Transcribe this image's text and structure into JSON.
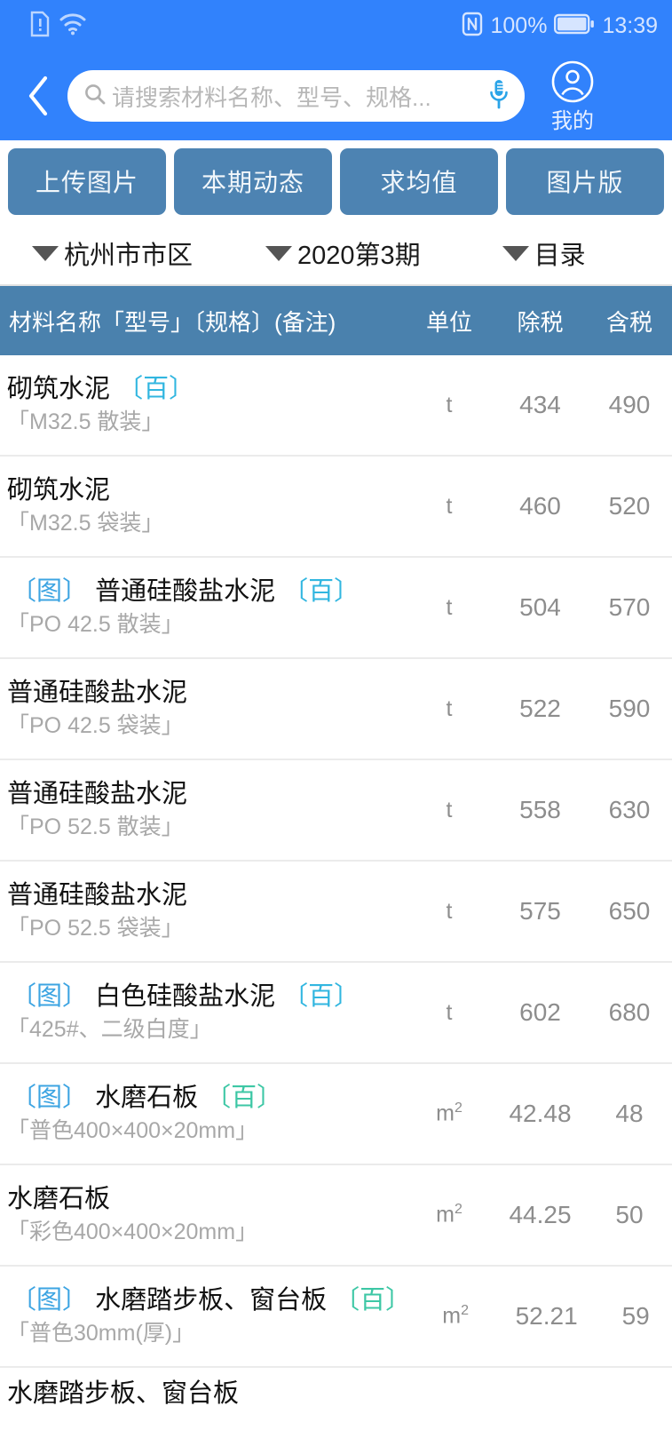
{
  "status_bar": {
    "icons_left": [
      "sim-card-alert-icon",
      "wifi-icon"
    ],
    "nfc_icon": "nfc-icon",
    "battery_percent": "100%",
    "battery_icon": "battery-full-icon",
    "time": "13:39"
  },
  "header": {
    "back_icon": "back-chevron-icon",
    "search": {
      "icon": "search-icon",
      "placeholder": "请搜索材料名称、型号、规格...",
      "value": "",
      "mic_icon": "microphone-icon"
    },
    "profile": {
      "icon": "user-avatar-icon",
      "label": "我的"
    }
  },
  "action_buttons": [
    {
      "label": "上传图片",
      "name": "upload-image-button"
    },
    {
      "label": "本期动态",
      "name": "current-period-trends-button"
    },
    {
      "label": "求均值",
      "name": "average-value-button"
    },
    {
      "label": "图片版",
      "name": "image-version-button"
    }
  ],
  "filters": [
    {
      "label": "杭州市市区",
      "name": "region-filter"
    },
    {
      "label": "2020第3期",
      "name": "period-filter"
    },
    {
      "label": "目录",
      "name": "catalog-filter"
    }
  ],
  "table": {
    "columns": [
      "材料名称「型号」〔规格〕(备注)",
      "单位",
      "除税",
      "含税"
    ],
    "rows": [
      {
        "img_tag": "",
        "name": "砌筑水泥",
        "bai_tag": "〔百〕",
        "bai_color": "blue",
        "spec": "「M32.5 散装」",
        "unit": "t",
        "unit_sup": "",
        "ex_tax": "434",
        "inc_tax": "490"
      },
      {
        "img_tag": "",
        "name": "砌筑水泥",
        "bai_tag": "",
        "bai_color": "",
        "spec": "「M32.5 袋装」",
        "unit": "t",
        "unit_sup": "",
        "ex_tax": "460",
        "inc_tax": "520"
      },
      {
        "img_tag": "〔图〕",
        "name": "普通硅酸盐水泥",
        "bai_tag": "〔百〕",
        "bai_color": "blue",
        "spec": "「PO 42.5 散装」",
        "unit": "t",
        "unit_sup": "",
        "ex_tax": "504",
        "inc_tax": "570"
      },
      {
        "img_tag": "",
        "name": "普通硅酸盐水泥",
        "bai_tag": "",
        "bai_color": "",
        "spec": "「PO 42.5 袋装」",
        "unit": "t",
        "unit_sup": "",
        "ex_tax": "522",
        "inc_tax": "590"
      },
      {
        "img_tag": "",
        "name": "普通硅酸盐水泥",
        "bai_tag": "",
        "bai_color": "",
        "spec": "「PO 52.5 散装」",
        "unit": "t",
        "unit_sup": "",
        "ex_tax": "558",
        "inc_tax": "630"
      },
      {
        "img_tag": "",
        "name": "普通硅酸盐水泥",
        "bai_tag": "",
        "bai_color": "",
        "spec": "「PO 52.5 袋装」",
        "unit": "t",
        "unit_sup": "",
        "ex_tax": "575",
        "inc_tax": "650"
      },
      {
        "img_tag": "〔图〕",
        "name": "白色硅酸盐水泥",
        "bai_tag": "〔百〕",
        "bai_color": "blue",
        "spec": "「425#、二级白度」",
        "unit": "t",
        "unit_sup": "",
        "ex_tax": "602",
        "inc_tax": "680"
      },
      {
        "img_tag": "〔图〕",
        "name": "水磨石板",
        "bai_tag": "〔百〕",
        "bai_color": "green",
        "spec": "「普色400×400×20mm」",
        "unit": "m",
        "unit_sup": "2",
        "ex_tax": "42.48",
        "inc_tax": "48"
      },
      {
        "img_tag": "",
        "name": "水磨石板",
        "bai_tag": "",
        "bai_color": "",
        "spec": "「彩色400×400×20mm」",
        "unit": "m",
        "unit_sup": "2",
        "ex_tax": "44.25",
        "inc_tax": "50"
      },
      {
        "img_tag": "〔图〕",
        "name": "水磨踏步板、窗台板",
        "bai_tag": "〔百〕",
        "bai_color": "green",
        "spec": "「普色30mm(厚)」",
        "unit": "m",
        "unit_sup": "2",
        "ex_tax": "52.21",
        "inc_tax": "59"
      }
    ],
    "partial_row": {
      "name": "水磨踏步板、窗台板"
    }
  },
  "colors": {
    "header_blue": "#3182fc",
    "button_blue": "#4d83b2",
    "table_header_blue": "#4a81ad",
    "tag_image_blue": "#3ca4e2",
    "tag_bai_blue": "#31b6e0",
    "tag_bai_green": "#3dc7a5",
    "value_gray": "#8d8d8d",
    "spec_gray": "#a8a8a8"
  }
}
